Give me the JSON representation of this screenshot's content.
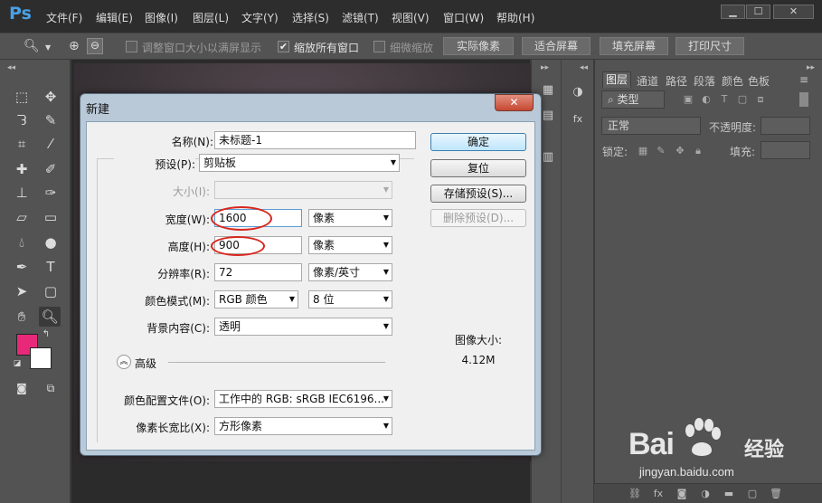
{
  "app": {
    "logo": "Ps",
    "menu": [
      "文件(F)",
      "编辑(E)",
      "图像(I)",
      "图层(L)",
      "文字(Y)",
      "选择(S)",
      "滤镜(T)",
      "视图(V)",
      "窗口(W)",
      "帮助(H)"
    ],
    "window_buttons": [
      "▁",
      "☐",
      "✕"
    ]
  },
  "options": {
    "resize_windows_label": "调整窗口大小以满屏显示",
    "zoom_all_label": "缩放所有窗口",
    "zoom_all_checked": true,
    "scrubby_label": "细微缩放",
    "actual_pixels": "实际像素",
    "fit_screen": "适合屏幕",
    "fill_screen": "填充屏幕",
    "print_size": "打印尺寸"
  },
  "layers": {
    "tabs": [
      "图层",
      "通道",
      "路径",
      "段落",
      "颜色",
      "色板"
    ],
    "filter_kind": "类型",
    "blend_mode": "正常",
    "opacity_label": "不透明度:",
    "lock_label": "锁定:",
    "fill_label": "填充:"
  },
  "dialog": {
    "title": "新建",
    "close": "✕",
    "name_label": "名称(N):",
    "name_value": "未标题-1",
    "preset_label": "预设(P):",
    "preset_value": "剪贴板",
    "size_label": "大小(I):",
    "width_label": "宽度(W):",
    "width_value": "1600",
    "width_unit": "像素",
    "height_label": "高度(H):",
    "height_value": "900",
    "height_unit": "像素",
    "resolution_label": "分辨率(R):",
    "resolution_value": "72",
    "resolution_unit": "像素/英寸",
    "color_mode_label": "颜色模式(M):",
    "color_mode_value": "RGB 颜色",
    "bit_depth": "8 位",
    "background_label": "背景内容(C):",
    "background_value": "透明",
    "advanced_label": "高级",
    "color_profile_label": "颜色配置文件(O):",
    "color_profile_value": "工作中的 RGB: sRGB IEC6196...",
    "pixel_aspect_label": "像素长宽比(X):",
    "pixel_aspect_value": "方形像素",
    "ok_button": "确定",
    "reset_button": "复位",
    "save_preset_button": "存储预设(S)...",
    "delete_preset_button": "删除预设(D)...",
    "image_size_label": "图像大小:",
    "image_size_value": "4.12M"
  },
  "colors": {
    "foreground": "#e8297a",
    "background": "#ffffff"
  },
  "watermark": {
    "brand": "Bai",
    "brand_tail": "经验",
    "url": "jingyan.baidu.com"
  }
}
